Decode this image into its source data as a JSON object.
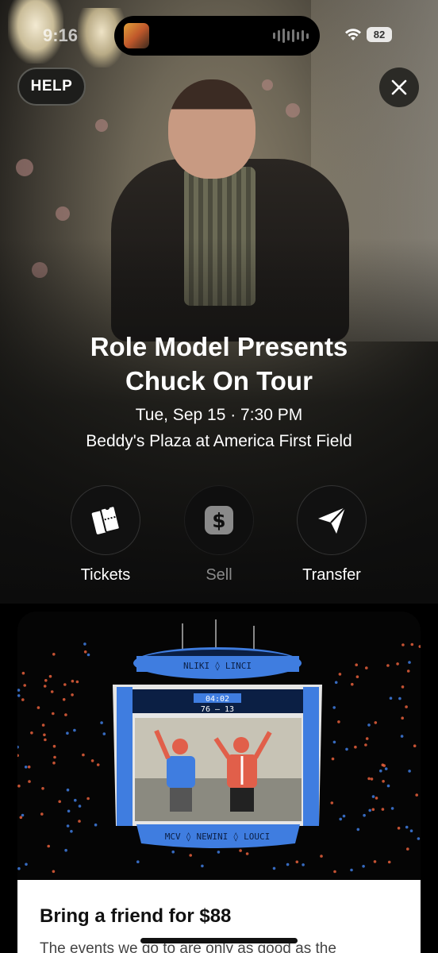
{
  "status_bar": {
    "time": "9:16",
    "battery": "82"
  },
  "header": {
    "help_label": "HELP"
  },
  "event": {
    "title_line1": "Role Model Presents",
    "title_line2": "Chuck On Tour",
    "date_time": "Tue, Sep 15 · 7:30 PM",
    "venue": "Beddy's Plaza at America First Field"
  },
  "actions": [
    {
      "label": "Tickets",
      "icon": "ticket-icon",
      "enabled": true
    },
    {
      "label": "Sell",
      "icon": "dollar-icon",
      "enabled": false
    },
    {
      "label": "Transfer",
      "icon": "send-icon",
      "enabled": true
    }
  ],
  "promo": {
    "title": "Bring a friend for $88",
    "body": "The events we go to are only as good as the",
    "scoreboard_clock": "04:02",
    "scoreboard_score": "76 – 13",
    "scoreboard_ribbon_top": "NLIKI ◊ LINCI",
    "scoreboard_ribbon_bottom": "MCV ◊ NEWINI ◊ LOUCI"
  },
  "colors": {
    "background": "#000000",
    "card_accent_blue": "#3f7de0",
    "card_accent_red": "#e8603c"
  }
}
